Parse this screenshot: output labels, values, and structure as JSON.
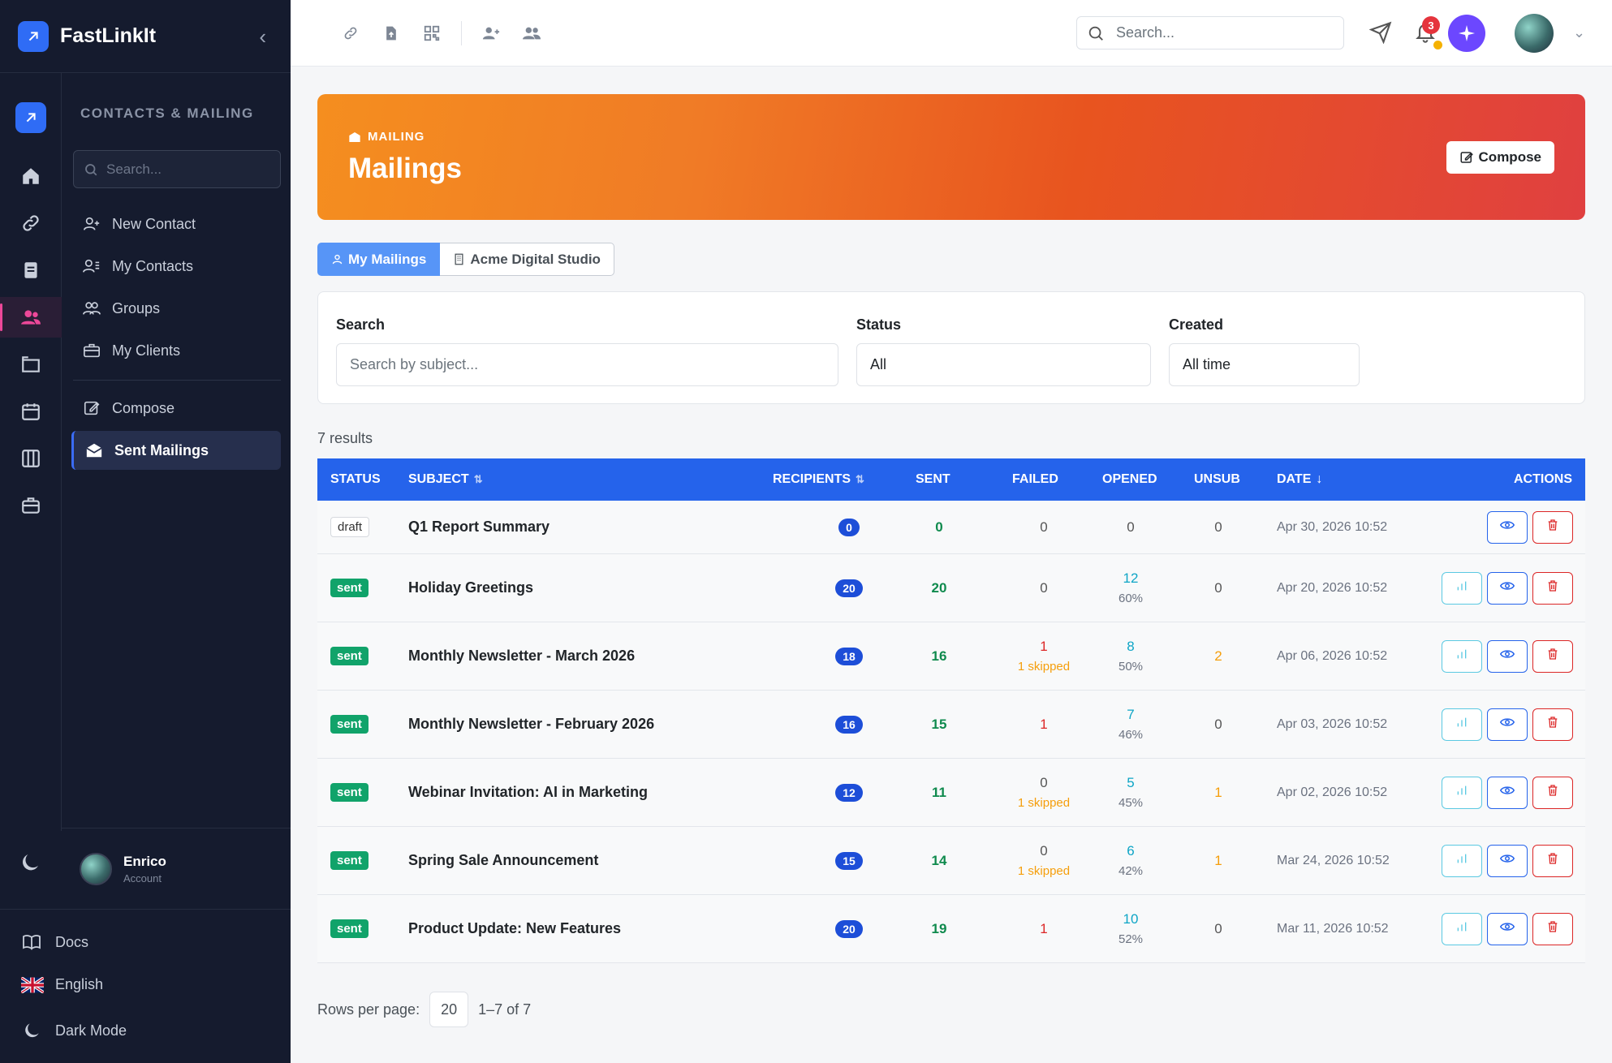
{
  "app": {
    "name": "FastLinkIt"
  },
  "sidebar": {
    "section_title": "CONTACTS & MAILING",
    "search_placeholder": "Search...",
    "items": [
      {
        "label": "New Contact"
      },
      {
        "label": "My Contacts"
      },
      {
        "label": "Groups"
      },
      {
        "label": "My Clients"
      },
      {
        "label": "Compose"
      },
      {
        "label": "Sent Mailings"
      }
    ],
    "active_item": "Sent Mailings",
    "user": {
      "name": "Enrico",
      "sub": "Account"
    },
    "bottom": {
      "docs": "Docs",
      "language": "English",
      "dark_mode": "Dark Mode"
    }
  },
  "topbar": {
    "search_placeholder": "Search...",
    "notification_count": "3"
  },
  "hero": {
    "kicker": "MAILING",
    "title": "Mailings",
    "compose_label": "Compose"
  },
  "tabs": [
    {
      "label": "My Mailings"
    },
    {
      "label": "Acme Digital Studio"
    }
  ],
  "filters": {
    "search_label": "Search",
    "search_placeholder": "Search by subject...",
    "status_label": "Status",
    "status_value": "All",
    "created_label": "Created",
    "created_value": "All time"
  },
  "results_text": "7 results",
  "table": {
    "headers": {
      "status": "STATUS",
      "subject": "SUBJECT",
      "recipients": "RECIPIENTS",
      "sent": "SENT",
      "failed": "FAILED",
      "opened": "OPENED",
      "unsub": "UNSUB",
      "date": "DATE",
      "actions": "ACTIONS"
    },
    "rows": [
      {
        "status": "draft",
        "subject": "Q1 Report Summary",
        "recipients": "0",
        "sent": "0",
        "failed": "0",
        "skipped": "",
        "opened": "0",
        "opened_pct": "",
        "unsub": "0",
        "date": "Apr 30, 2026 10:52"
      },
      {
        "status": "sent",
        "subject": "Holiday Greetings",
        "recipients": "20",
        "sent": "20",
        "failed": "0",
        "skipped": "",
        "opened": "12",
        "opened_pct": "60%",
        "unsub": "0",
        "date": "Apr 20, 2026 10:52"
      },
      {
        "status": "sent",
        "subject": "Monthly Newsletter - March 2026",
        "recipients": "18",
        "sent": "16",
        "failed": "1",
        "skipped": "1 skipped",
        "opened": "8",
        "opened_pct": "50%",
        "unsub": "2",
        "date": "Apr 06, 2026 10:52"
      },
      {
        "status": "sent",
        "subject": "Monthly Newsletter - February 2026",
        "recipients": "16",
        "sent": "15",
        "failed": "1",
        "skipped": "",
        "opened": "7",
        "opened_pct": "46%",
        "unsub": "0",
        "date": "Apr 03, 2026 10:52"
      },
      {
        "status": "sent",
        "subject": "Webinar Invitation: AI in Marketing",
        "recipients": "12",
        "sent": "11",
        "failed": "0",
        "skipped": "1 skipped",
        "opened": "5",
        "opened_pct": "45%",
        "unsub": "1",
        "date": "Apr 02, 2026 10:52"
      },
      {
        "status": "sent",
        "subject": "Spring Sale Announcement",
        "recipients": "15",
        "sent": "14",
        "failed": "0",
        "skipped": "1 skipped",
        "opened": "6",
        "opened_pct": "42%",
        "unsub": "1",
        "date": "Mar 24, 2026 10:52"
      },
      {
        "status": "sent",
        "subject": "Product Update: New Features",
        "recipients": "20",
        "sent": "19",
        "failed": "1",
        "skipped": "",
        "opened": "10",
        "opened_pct": "52%",
        "unsub": "0",
        "date": "Mar 11, 2026 10:52"
      }
    ]
  },
  "pager": {
    "rows_label": "Rows per page:",
    "rows_value": "20",
    "range": "1–7 of 7"
  }
}
